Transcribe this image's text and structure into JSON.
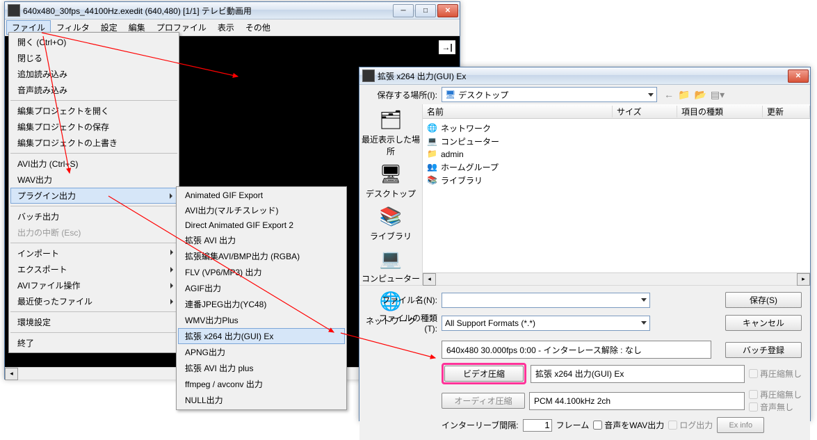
{
  "mainWindow": {
    "title": "640x480_30fps_44100Hz.exedit (640,480)  [1/1]  テレビ動画用",
    "menu": [
      "ファイル",
      "フィルタ",
      "設定",
      "編集",
      "プロファイル",
      "表示",
      "その他"
    ]
  },
  "fileMenu": {
    "items": [
      "開く (Ctrl+O)",
      "閉じる",
      "追加読み込み",
      "音声読み込み",
      "編集プロジェクトを開く",
      "編集プロジェクトの保存",
      "編集プロジェクトの上書き",
      "AVI出力 (Ctrl+S)",
      "WAV出力",
      "プラグイン出力",
      "バッチ出力",
      "出力の中断 (Esc)",
      "インポート",
      "エクスポート",
      "AVIファイル操作",
      "最近使ったファイル",
      "環境設定",
      "終了"
    ]
  },
  "pluginSubmenu": {
    "items": [
      "Animated GIF Export",
      "AVI出力(マルチスレッド)",
      "Direct Animated GIF Export 2",
      "拡張 AVI 出力",
      "拡張編集AVI/BMP出力 (RGBA)",
      "FLV (VP6/MP3) 出力",
      "AGIF出力",
      "連番JPEG出力(YC48)",
      "WMV出力Plus",
      "拡張 x264 出力(GUI) Ex",
      "APNG出力",
      "拡張 AVI 出力 plus",
      "ffmpeg / avconv 出力",
      "NULL出力"
    ]
  },
  "saveDialog": {
    "title": "拡張 x264 出力(GUI) Ex",
    "saveLocationLabel": "保存する場所(I):",
    "saveLocationValue": "デスクトップ",
    "nav": [
      "最近表示した場所",
      "デスクトップ",
      "ライブラリ",
      "コンピューター",
      "ネットワーク"
    ],
    "columns": {
      "name": "名前",
      "size": "サイズ",
      "type": "項目の種類",
      "update": "更新"
    },
    "files": [
      "ネットワーク",
      "コンピューター",
      "admin",
      "ホームグループ",
      "ライブラリ"
    ],
    "fileNameLabel": "ファイル名(N):",
    "fileTypeLabel": "ファイルの種類(T):",
    "fileTypeValue": "All Support Formats (*.*)",
    "saveBtn": "保存(S)",
    "cancelBtn": "キャンセル",
    "infoLine": "640x480  30.000fps  0:00  -  インターレース解除 : なし",
    "batchBtn": "バッチ登録",
    "videoBtn": "ビデオ圧縮",
    "videoInfo": "拡張 x264 出力(GUI) Ex",
    "audioBtn": "オーディオ圧縮",
    "audioInfo": "PCM 44.100kHz 2ch",
    "interleaveLabel": "インターリーブ間隔:",
    "interleaveVal": "1",
    "interleaveUnit": "フレーム",
    "wavOut": "音声をWAV出力",
    "logOut": "ログ出力",
    "exInfo": "Ex info",
    "noRecomp": "再圧縮無し",
    "noAudio": "音声無し"
  }
}
